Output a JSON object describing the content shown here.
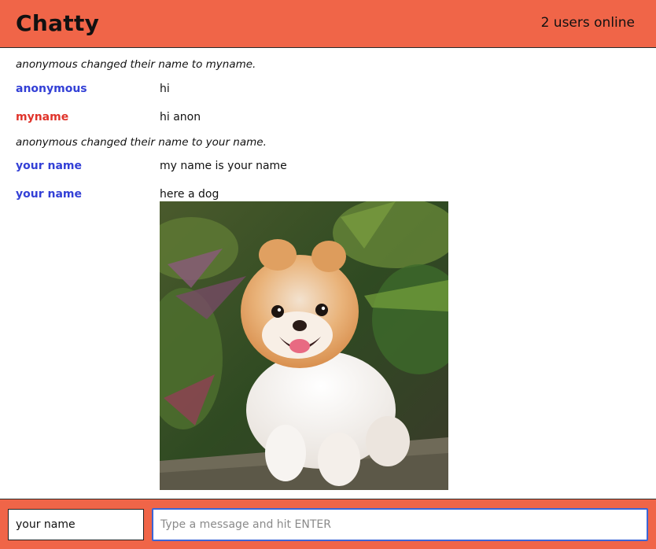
{
  "header": {
    "title": "Chatty",
    "online_status": "2 users online"
  },
  "colors": {
    "brand": "#f06548",
    "user_blue": "#3340d6",
    "user_red": "#e0342b",
    "input_focus": "#3c66d6"
  },
  "messages": [
    {
      "type": "notice",
      "text": "anonymous changed their name to myname."
    },
    {
      "type": "message",
      "user": "anonymous",
      "user_color": "#3340d6",
      "text": "hi"
    },
    {
      "type": "message",
      "user": "myname",
      "user_color": "#e0342b",
      "text": "hi anon"
    },
    {
      "type": "notice",
      "text": "anonymous changed their name to your name."
    },
    {
      "type": "message",
      "user": "your name",
      "user_color": "#3340d6",
      "text": "my name is your name"
    },
    {
      "type": "message",
      "user": "your name",
      "user_color": "#3340d6",
      "text": "here a dog",
      "attachment": "dog-photo"
    }
  ],
  "composer": {
    "name_value": "your name",
    "message_placeholder": "Type a message and hit ENTER"
  }
}
